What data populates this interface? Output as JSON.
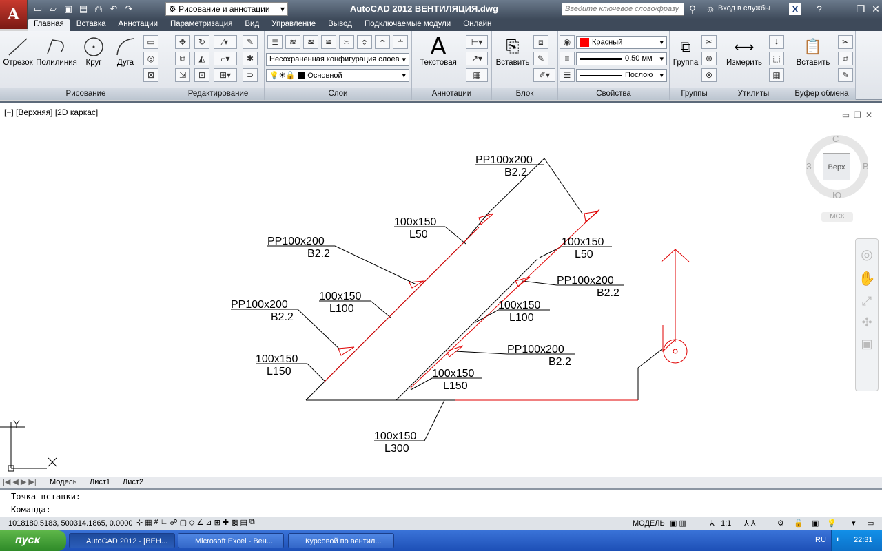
{
  "titlebar": {
    "logo": "A",
    "workspace": "Рисование и аннотации",
    "title": "AutoCAD 2012    ВЕНТИЛЯЦИЯ.dwg",
    "search_placeholder": "Введите ключевое слово/фразу",
    "signin": "Вход в службы"
  },
  "tabs": [
    "Главная",
    "Вставка",
    "Аннотации",
    "Параметризация",
    "Вид",
    "Управление",
    "Вывод",
    "Подключаемые модули",
    "Онлайн"
  ],
  "ribbon": {
    "draw": {
      "title": "Рисование",
      "line": "Отрезок",
      "polyline": "Полилиния",
      "circle": "Круг",
      "arc": "Дуга"
    },
    "modify": {
      "title": "Редактирование"
    },
    "layers": {
      "title": "Слои",
      "state": "Несохраненная конфигурация слоев",
      "current": "Основной"
    },
    "annotations": {
      "title": "Аннотации",
      "text": "Текстовая"
    },
    "block": {
      "title": "Блок",
      "insert": "Вставить"
    },
    "properties": {
      "title": "Свойства",
      "color": "Красный",
      "lineweight": "0.50 мм",
      "linetype": "Послою"
    },
    "groups": {
      "title": "Группы",
      "group": "Группа"
    },
    "utilities": {
      "title": "Утилиты",
      "measure": "Измерить"
    },
    "clipboard": {
      "title": "Буфер обмена",
      "paste": "Вставить"
    }
  },
  "viewport": {
    "label": "[−] [Верхняя] [2D каркас]",
    "viewcube": {
      "top": "Верх",
      "n": "С",
      "s": "Ю",
      "w": "З",
      "e": "В",
      "ucs": "МСК"
    }
  },
  "drawing_labels": [
    {
      "a": "PP100x200",
      "b": "B2.2"
    },
    {
      "a": "100x150",
      "b": "L50"
    },
    {
      "a": "PP100x200",
      "b": "B2.2"
    },
    {
      "a": "100x150",
      "b": "L50"
    },
    {
      "a": "PP100x200",
      "b": "B2.2"
    },
    {
      "a": "100x150",
      "b": "L100"
    },
    {
      "a": "PP100x200",
      "b": "B2.2"
    },
    {
      "a": "100x150",
      "b": "L100"
    },
    {
      "a": "100x150",
      "b": "L150"
    },
    {
      "a": "PP100x200",
      "b": "B2.2"
    },
    {
      "a": "100x150",
      "b": "L150"
    },
    {
      "a": "100x150",
      "b": "L300"
    }
  ],
  "layout_tabs": [
    "Модель",
    "Лист1",
    "Лист2"
  ],
  "command": {
    "prev": "Точка вставки:",
    "prompt": "Команда:"
  },
  "status": {
    "coords": "1018180.5183, 500314.1865, 0.0000",
    "space": "МОДЕЛЬ",
    "scale": "1:1"
  },
  "taskbar": {
    "start": "пуск",
    "tasks": [
      "AutoCAD 2012 - [ВЕН...",
      "Microsoft Excel - Вен...",
      "Курсовой по вентил..."
    ],
    "lang": "RU",
    "time": "22:31"
  }
}
